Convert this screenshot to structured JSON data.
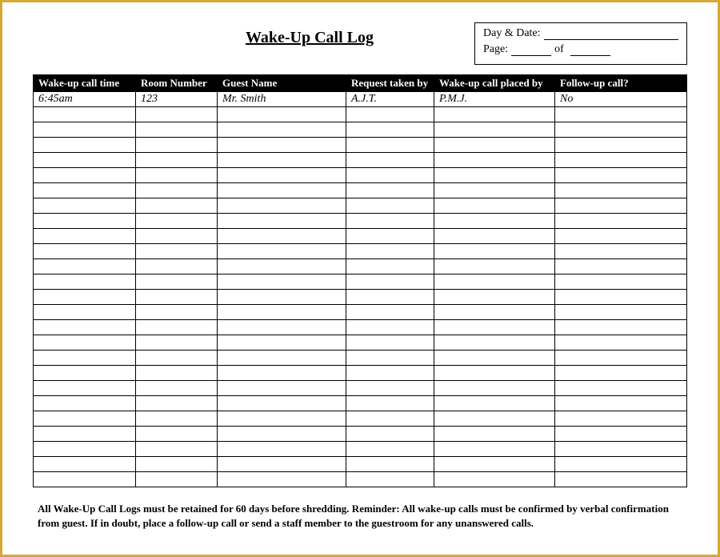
{
  "title": "Wake-Up Call Log",
  "meta": {
    "day_date_label": "Day & Date:",
    "page_label": "Page:",
    "of_label": "of"
  },
  "columns": [
    "Wake-up call time",
    "Room Number",
    "Guest Name",
    "Request taken by",
    "Wake-up call placed by",
    "Follow-up call?"
  ],
  "rows": [
    {
      "time": "6:45am",
      "room": "123",
      "guest": "Mr. Smith",
      "req": "A.J.T.",
      "placed": "P.M.J.",
      "follow": "No"
    },
    {
      "time": "",
      "room": "",
      "guest": "",
      "req": "",
      "placed": "",
      "follow": ""
    },
    {
      "time": "",
      "room": "",
      "guest": "",
      "req": "",
      "placed": "",
      "follow": ""
    },
    {
      "time": "",
      "room": "",
      "guest": "",
      "req": "",
      "placed": "",
      "follow": ""
    },
    {
      "time": "",
      "room": "",
      "guest": "",
      "req": "",
      "placed": "",
      "follow": ""
    },
    {
      "time": "",
      "room": "",
      "guest": "",
      "req": "",
      "placed": "",
      "follow": ""
    },
    {
      "time": "",
      "room": "",
      "guest": "",
      "req": "",
      "placed": "",
      "follow": ""
    },
    {
      "time": "",
      "room": "",
      "guest": "",
      "req": "",
      "placed": "",
      "follow": ""
    },
    {
      "time": "",
      "room": "",
      "guest": "",
      "req": "",
      "placed": "",
      "follow": ""
    },
    {
      "time": "",
      "room": "",
      "guest": "",
      "req": "",
      "placed": "",
      "follow": ""
    },
    {
      "time": "",
      "room": "",
      "guest": "",
      "req": "",
      "placed": "",
      "follow": ""
    },
    {
      "time": "",
      "room": "",
      "guest": "",
      "req": "",
      "placed": "",
      "follow": ""
    },
    {
      "time": "",
      "room": "",
      "guest": "",
      "req": "",
      "placed": "",
      "follow": ""
    },
    {
      "time": "",
      "room": "",
      "guest": "",
      "req": "",
      "placed": "",
      "follow": ""
    },
    {
      "time": "",
      "room": "",
      "guest": "",
      "req": "",
      "placed": "",
      "follow": ""
    },
    {
      "time": "",
      "room": "",
      "guest": "",
      "req": "",
      "placed": "",
      "follow": ""
    },
    {
      "time": "",
      "room": "",
      "guest": "",
      "req": "",
      "placed": "",
      "follow": ""
    },
    {
      "time": "",
      "room": "",
      "guest": "",
      "req": "",
      "placed": "",
      "follow": ""
    },
    {
      "time": "",
      "room": "",
      "guest": "",
      "req": "",
      "placed": "",
      "follow": ""
    },
    {
      "time": "",
      "room": "",
      "guest": "",
      "req": "",
      "placed": "",
      "follow": ""
    },
    {
      "time": "",
      "room": "",
      "guest": "",
      "req": "",
      "placed": "",
      "follow": ""
    },
    {
      "time": "",
      "room": "",
      "guest": "",
      "req": "",
      "placed": "",
      "follow": ""
    },
    {
      "time": "",
      "room": "",
      "guest": "",
      "req": "",
      "placed": "",
      "follow": ""
    },
    {
      "time": "",
      "room": "",
      "guest": "",
      "req": "",
      "placed": "",
      "follow": ""
    },
    {
      "time": "",
      "room": "",
      "guest": "",
      "req": "",
      "placed": "",
      "follow": ""
    },
    {
      "time": "",
      "room": "",
      "guest": "",
      "req": "",
      "placed": "",
      "follow": ""
    }
  ],
  "footer": "All Wake-Up Call Logs must be retained for 60 days before shredding. Reminder: All wake-up calls must be confirmed by verbal confirmation from guest. If in doubt, place a follow-up call or send a staff member to the guestroom for any unanswered calls."
}
